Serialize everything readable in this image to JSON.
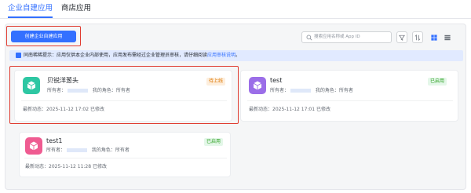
{
  "tabs": [
    {
      "label": "企业自建应用",
      "active": true
    },
    {
      "label": "商店应用",
      "active": false
    }
  ],
  "toolbar": {
    "create_label": "创建企业自建应用",
    "search_placeholder": "搜索应用名称或 App ID"
  },
  "notice": {
    "text": "同南稀稀提示：应用仅供本企业内部使用，应用发布需经过企业管理员审核，请仔细阅读",
    "link": "应用审核说明",
    "suffix": "。"
  },
  "apps": [
    {
      "name": "贝锐洋葱头",
      "status": "待上线",
      "owner_label": "所有者：",
      "role": "我的角色：所有者",
      "updated": "最新动态：2025-11-12 17:02 已修改",
      "icon_color": "#2ec7a3"
    },
    {
      "name": "test",
      "status": "已启用",
      "owner_label": "所有者：",
      "role": "我的角色：所有者",
      "updated": "最新动态：2025-11-12 17:01 已修改",
      "icon_color": "#9b6ee8"
    },
    {
      "name": "test1",
      "status": "已启用",
      "owner_label": "所有者：",
      "role": "我的角色：所有者",
      "updated": "最新动态：2025-11-12 11:28 已修改",
      "icon_color": "#ef5b91"
    }
  ],
  "colors": {
    "accent": "#3370ff",
    "highlight": "#e03c31",
    "pending": "#de7802",
    "live": "#2ea121"
  },
  "icons": [
    "search-icon",
    "filter-icon",
    "sort-icon",
    "grid-view-icon",
    "list-view-icon",
    "info-icon",
    "app-cube-icon"
  ]
}
